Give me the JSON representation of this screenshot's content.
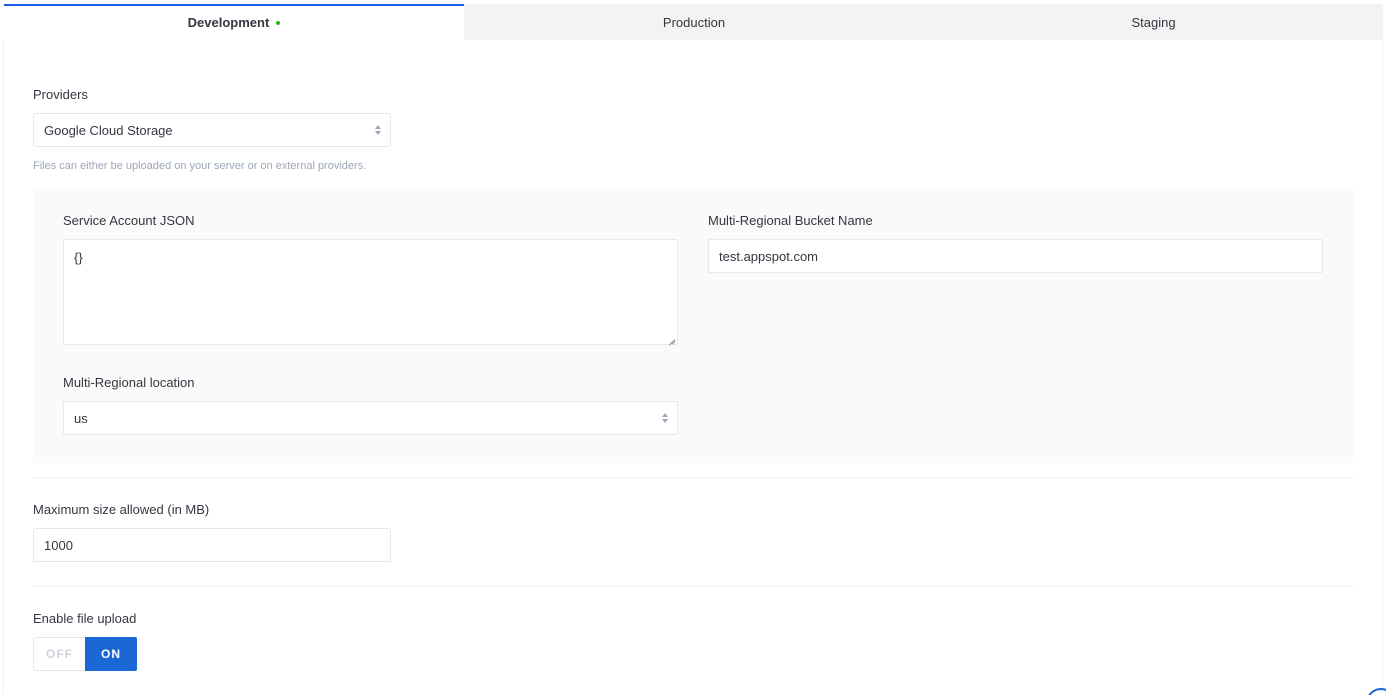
{
  "tabs": [
    {
      "label": "Development",
      "active": true,
      "status_dot": true
    },
    {
      "label": "Production",
      "active": false
    },
    {
      "label": "Staging",
      "active": false
    }
  ],
  "providers": {
    "label": "Providers",
    "selected": "Google Cloud Storage",
    "hint": "Files can either be uploaded on your server or on external providers."
  },
  "gcs": {
    "service_account": {
      "label": "Service Account JSON",
      "value": "{}"
    },
    "bucket": {
      "label": "Multi-Regional Bucket Name",
      "value": "test.appspot.com"
    },
    "location": {
      "label": "Multi-Regional location",
      "selected": "us"
    }
  },
  "max_size": {
    "label": "Maximum size allowed (in MB)",
    "value": "1000"
  },
  "enable_upload": {
    "label": "Enable file upload",
    "off_label": "OFF",
    "on_label": "ON",
    "state": "on"
  },
  "colors": {
    "accent": "#1a67d6",
    "status_green": "#27b70f",
    "tab_active_border": "#1c5de7"
  }
}
